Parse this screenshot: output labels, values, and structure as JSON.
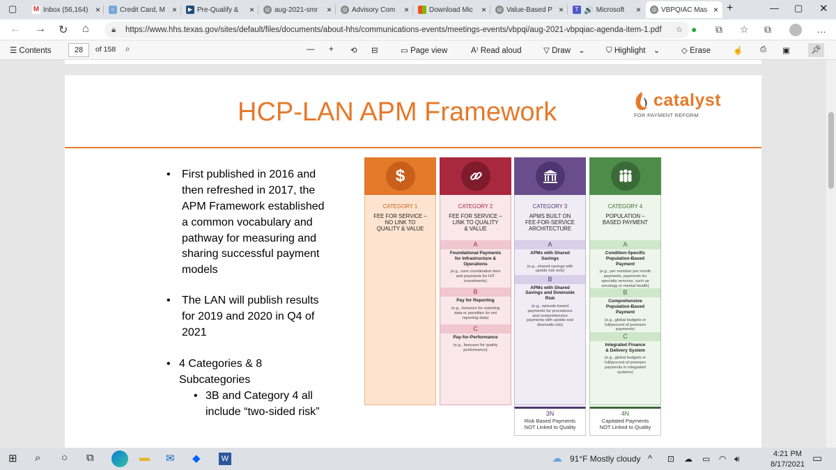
{
  "tabs": [
    {
      "label": "",
      "icon": "window-icon"
    },
    {
      "label": "Inbox (56,164)",
      "icon": "gmail-icon",
      "color": "#d93025"
    },
    {
      "label": "Credit Card, M",
      "icon": "link-icon",
      "color": "#7aa7d8"
    },
    {
      "label": "Pre-Qualify &",
      "icon": "doc-icon",
      "color": "#1f4e79"
    },
    {
      "label": "aug-2021-smr",
      "icon": "pdf-icon",
      "color": "#666"
    },
    {
      "label": "Advisory Com",
      "icon": "pdf-icon",
      "color": "#666"
    },
    {
      "label": "Download Mic",
      "icon": "ms-icon",
      "color": "#f25022"
    },
    {
      "label": "Value-Based P",
      "icon": "pdf-icon",
      "color": "#666"
    },
    {
      "label": "Microsoft",
      "icon": "teams-icon",
      "color": "#5059c9"
    },
    {
      "label": "VBPQIAC Mas",
      "icon": "pdf-icon",
      "color": "#666"
    }
  ],
  "url": "https://www.hhs.texas.gov/sites/default/files/documents/about-hhs/communications-events/meetings-events/vbpqi/aug-2021-vbpqiac-agenda-item-1.pdf",
  "pdf_toolbar": {
    "contents": "Contents",
    "page": "28",
    "of": "of 158",
    "page_view": "Page view",
    "read_aloud": "Read aloud",
    "draw": "Draw",
    "highlight": "Highlight",
    "erase": "Erase"
  },
  "slide": {
    "title": "HCP-LAN APM Framework",
    "logo_name": "catalyst",
    "logo_sub": "FOR PAYMENT REFORM",
    "bullets": [
      "First published in 2016 and",
      "then refreshed in 2017, the",
      "APM Framework established",
      "a common vocabulary and",
      "pathway for measuring and",
      "sharing successful payment",
      "models",
      "The LAN will publish results",
      "for 2019 and 2020 in Q4 of",
      "2021",
      "4 Categories & 8",
      "Subcategories",
      "3B and Category 4 all",
      "include “two-sided risk”"
    ],
    "categories": [
      {
        "label": "CATEGORY 1",
        "desc": "FEE FOR SERVICE –\nNO LINK TO\nQUALITY & VALUE",
        "icon_glyph": "$",
        "color": "#e5792a",
        "light": "#fde4d0",
        "icon": "dollar-icon"
      },
      {
        "label": "CATEGORY 2",
        "desc": "FEE FOR SERVICE –\nLINK TO QUALITY\n& VALUE",
        "icon_glyph": "🔗",
        "color": "#a8283d",
        "light": "#f4d4da",
        "icon": "chain-link-icon"
      },
      {
        "label": "CATEGORY 3",
        "desc": "APMS BUILT ON\nFEE-FOR-SERVICE\nARCHITECTURE",
        "icon_glyph": "🏛",
        "color": "#6a4e8c",
        "light": "#e3dcee",
        "icon": "building-icon"
      },
      {
        "label": "CATEGORY 4",
        "desc": "POPULATION –\nBASED PAYMENT",
        "icon_glyph": "👥",
        "color": "#4e8c4a",
        "light": "#dbeed8",
        "icon": "people-icon"
      }
    ],
    "cat2_subs": [
      {
        "letter": "A",
        "title": "Foundational Payments\nfor Infrastructure &\nOperations",
        "desc": "(e.g., care coordination fees\nand payments for HIT\ninvestments)"
      },
      {
        "letter": "B",
        "title": "Pay for Reporting",
        "desc": "(e.g., bonuses for reporting\ndata or penalties for not\nreporting data)"
      },
      {
        "letter": "C",
        "title": "Pay-for-Performance",
        "desc": "(e.g., bonuses for quality\nperformance)"
      }
    ],
    "cat3_subs": [
      {
        "letter": "A",
        "title": "APMs with Shared\nSavings",
        "desc": "(e.g., shared savings with\nupside risk only)"
      },
      {
        "letter": "B",
        "title": "APMs with Shared\nSavings and Downside\nRisk",
        "desc": "(e.g., episode-based\npayments for procedures\nand comprehensive\npayments with upside and\ndownside risk)"
      }
    ],
    "cat4_subs": [
      {
        "letter": "A",
        "title": "Condition-Specific\nPopulation-Based\nPayment",
        "desc": "(e.g., per member per month\npayments, payments for\nspecialty services, such as\noncology or mental health)"
      },
      {
        "letter": "B",
        "title": "Comprehensive\nPopulation-Based\nPayment",
        "desc": "(e.g., global budgets or\nfull/percent of premium\npayments)"
      },
      {
        "letter": "C",
        "title": "Integrated Finance\n& Delivery System",
        "desc": "(e.g., global budgets or\nfull/percent of premium\npayments in integrated\nsystems)"
      }
    ],
    "n3": {
      "code": "3N",
      "text": "Risk Based Payments\nNOT Linked to Quality"
    },
    "n4": {
      "code": "4N",
      "text": "Capitated Payments\nNOT Linked to Quality"
    }
  },
  "taskbar": {
    "weather": "91°F  Mostly cloudy",
    "time": "4:21 PM",
    "date": "8/17/2021"
  }
}
